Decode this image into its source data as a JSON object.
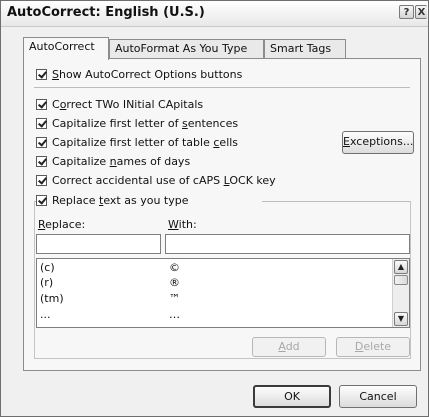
{
  "window": {
    "title": "AutoCorrect: English (U.S.)",
    "help_glyph": "?",
    "close_glyph": "X"
  },
  "tabs": [
    {
      "label": "AutoCorrect",
      "active": true
    },
    {
      "label": "AutoFormat As You Type",
      "active": false
    },
    {
      "label": "Smart Tags",
      "active": false
    }
  ],
  "options": {
    "show_buttons": {
      "pre": "",
      "key": "S",
      "post": "how AutoCorrect Options buttons",
      "checked": true
    },
    "two_initials": {
      "pre": "C",
      "key": "o",
      "post": "rrect TWo INitial CApitals",
      "checked": true
    },
    "sentences": {
      "pre": "Capitalize first letter of ",
      "key": "s",
      "post": "entences",
      "checked": true
    },
    "table_cells": {
      "pre": "Capitalize first letter of table ",
      "key": "c",
      "post": "ells",
      "checked": true
    },
    "days": {
      "pre": "Capitalize ",
      "key": "n",
      "post": "ames of days",
      "checked": true
    },
    "caps_lock": {
      "pre": "Correct accidental use of cAPS ",
      "key": "L",
      "post": "OCK key",
      "checked": true
    },
    "replace_text": {
      "pre": "Replace ",
      "key": "t",
      "post": "ext as you type",
      "checked": true
    }
  },
  "exceptions_button": {
    "key": "E",
    "post": "xceptions..."
  },
  "replace_section": {
    "replace_label": {
      "key": "R",
      "post": "eplace:"
    },
    "with_label": {
      "key": "W",
      "post": "ith:"
    },
    "replace_value": "",
    "with_value": ""
  },
  "entries": [
    {
      "replace": "(c)",
      "with": "©"
    },
    {
      "replace": "(r)",
      "with": "®"
    },
    {
      "replace": "(tm)",
      "with": "™"
    },
    {
      "replace": "...",
      "with": "…"
    }
  ],
  "list_buttons": {
    "add": {
      "key": "A",
      "post": "dd",
      "enabled": false
    },
    "delete": {
      "key": "D",
      "post": "elete",
      "enabled": false
    }
  },
  "footer": {
    "ok_label": "OK",
    "cancel_label": "Cancel"
  }
}
